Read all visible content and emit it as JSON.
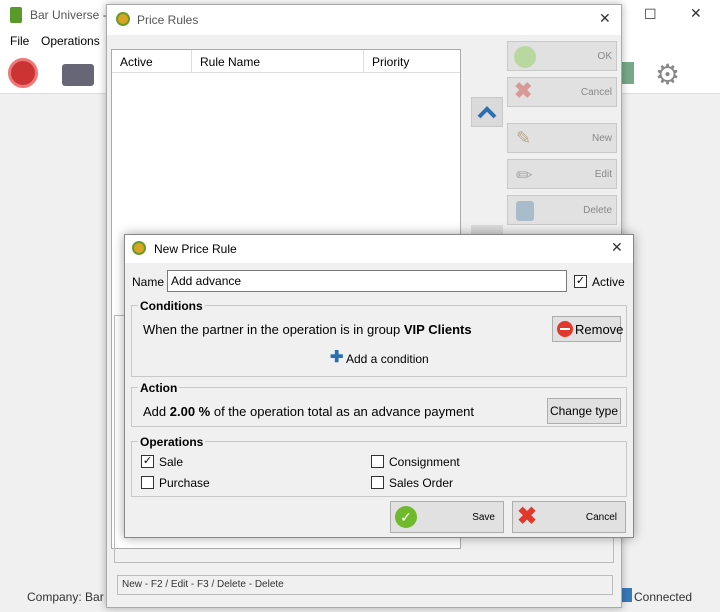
{
  "main": {
    "title": "Bar Universe -",
    "menu": [
      "File",
      "Operations"
    ],
    "status_company": "Company: Bar",
    "status_conn": "Connected"
  },
  "price_rules": {
    "title": "Price Rules",
    "columns": [
      "Active",
      "Rule Name",
      "Priority"
    ],
    "side_buttons": [
      "OK",
      "Cancel",
      "New",
      "Edit",
      "Delete"
    ],
    "hint": "New - F2 / Edit - F3 / Delete - Delete"
  },
  "dialog": {
    "title": "New Price Rule",
    "name_label": "Name",
    "name_value": "Add advance",
    "active_label": "Active",
    "conditions": {
      "title": "Conditions",
      "text_prefix": "When the partner in the operation is in group ",
      "text_group": "VIP Clients",
      "remove_label": "Remove",
      "add_label": "Add a condition"
    },
    "action": {
      "title": "Action",
      "text_prefix": "Add ",
      "text_value": "2.00 %",
      "text_suffix": " of the operation total as an advance payment",
      "change_label": "Change type"
    },
    "operations": {
      "title": "Operations",
      "items": [
        {
          "label": "Sale",
          "checked": true
        },
        {
          "label": "Consignment",
          "checked": false
        },
        {
          "label": "Purchase",
          "checked": false
        },
        {
          "label": "Sales Order",
          "checked": false
        }
      ]
    },
    "save_label": "Save",
    "cancel_label": "Cancel"
  },
  "colors": {
    "accent": "#2a6fb0",
    "ok_green": "#6fba2c",
    "cancel_red": "#e03a2e"
  }
}
